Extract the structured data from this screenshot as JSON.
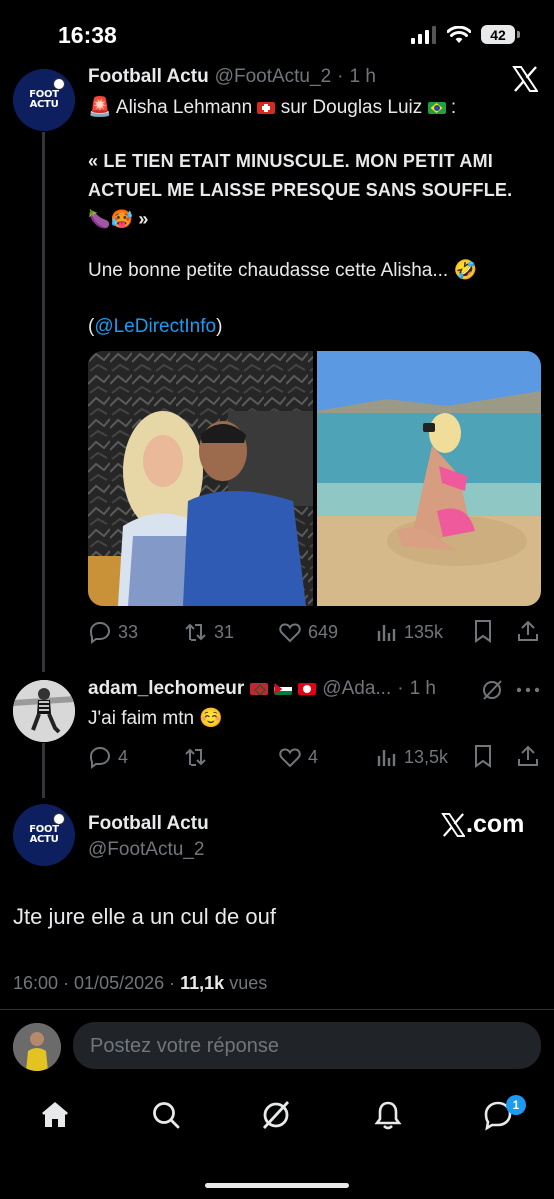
{
  "status_bar": {
    "time": "16:38",
    "battery": "42"
  },
  "colors": {
    "background": "#000000",
    "text": "#e7e9ea",
    "muted": "#71767b",
    "link": "#1d9bf0"
  },
  "tweet1": {
    "author_name": "Football Actu",
    "author_handle": "@FootActu_2",
    "time": "1 h",
    "avatar_text": [
      "FOOT",
      "ACTU"
    ],
    "line1_prefix": "Alisha Lehmann",
    "line1_middle": "sur Douglas Luiz",
    "line1_suffix": ":",
    "quote_open": "« LE TIEN ETAIT MINUSCULE. MON PETIT AMI ACTUEL ME LAISSE PRESQUE SANS SOUFFLE.",
    "quote_close": "🍆🥵 »",
    "comment": "Une bonne petite chaudasse cette Alisha... 🤣",
    "paren_open": "(",
    "mention": "@LeDirectInfo",
    "paren_close": ")",
    "stats": {
      "replies": "33",
      "retweets": "31",
      "likes": "649",
      "views": "135k"
    }
  },
  "tweet2": {
    "author_name": "adam_lechomeur",
    "author_handle": "@Ada...",
    "time": "1 h",
    "text": "J'ai faim mtn ☺️",
    "stats": {
      "replies": "4",
      "retweets": "",
      "likes": "4",
      "views": "13,5k"
    }
  },
  "tweet3": {
    "author_name": "Football Actu",
    "author_handle": "@FootActu_2",
    "source": ".com",
    "text": "Jte jure elle a un cul de ouf",
    "date": "16:00 · 01/05/2026 ·",
    "views_count": "11,1k",
    "views_label": "vues"
  },
  "reply": {
    "placeholder": "Postez votre réponse"
  },
  "nav": {
    "messages_badge": "1"
  },
  "icons": [
    "x-logo-icon",
    "alarm-siren-icon",
    "reply-icon",
    "retweet-icon",
    "like-icon",
    "views-icon",
    "bookmark-icon",
    "share-icon",
    "grok-icon",
    "more-icon",
    "home-icon",
    "search-icon",
    "notifications-icon",
    "messages-icon"
  ]
}
